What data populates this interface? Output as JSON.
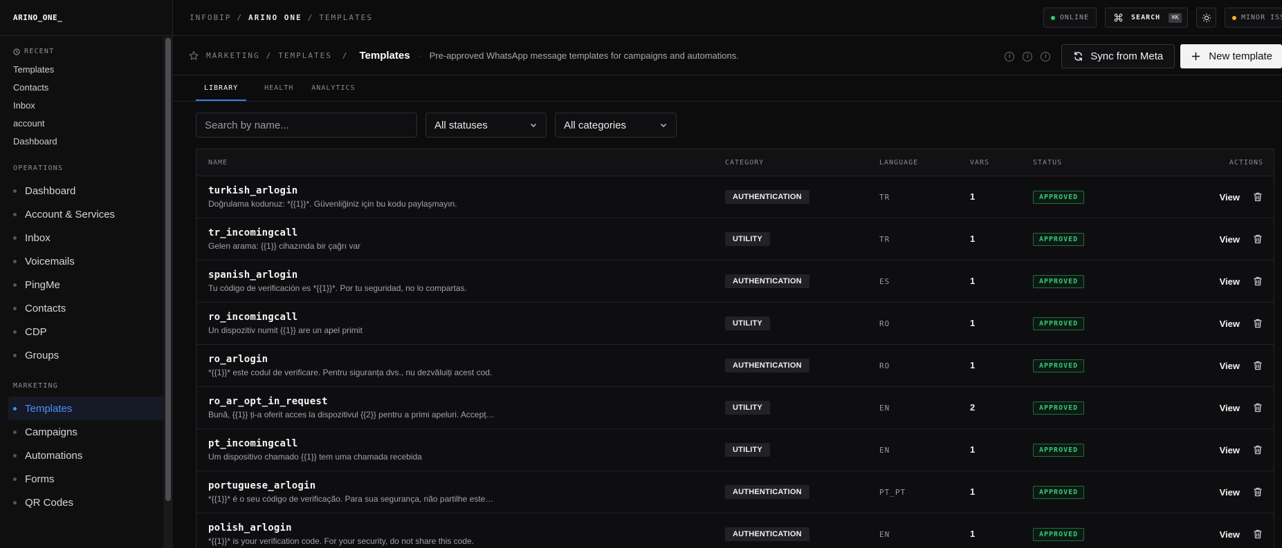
{
  "brand": "ARINO_ONE_",
  "sidebar": {
    "recent_heading": "RECENT",
    "recent": [
      "Templates",
      "Contacts",
      "Inbox",
      "account",
      "Dashboard"
    ],
    "operations_heading": "OPERATIONS",
    "operations": [
      "Dashboard",
      "Account & Services",
      "Inbox",
      "Voicemails",
      "PingMe",
      "Contacts",
      "CDP",
      "Groups"
    ],
    "marketing_heading": "MARKETING",
    "marketing": [
      "Templates",
      "Campaigns",
      "Automations",
      "Forms",
      "QR Codes"
    ],
    "active_item": "Templates",
    "accent": "#4d8dff"
  },
  "topbar": {
    "crumbs": [
      "INFOBIP",
      "/",
      "ARINO ONE",
      "/",
      "TEMPLATES"
    ],
    "online_label": "ONLINE",
    "online_color": "#2ecc71",
    "search_label": "SEARCH",
    "search_shortcut": "⌘K",
    "issue_label": "MINOR ISSUE",
    "issue_color": "#f0b429"
  },
  "page": {
    "crumb_1": "MARKETING",
    "crumb_sep": "/",
    "crumb_2": "TEMPLATES",
    "crumb_sep2": "/",
    "title": "Templates",
    "sep": "·",
    "description": "Pre-approved WhatsApp message templates for campaigns and automations.",
    "sync_label": "Sync from Meta",
    "new_label": "New template"
  },
  "tabs": [
    "LIBRARY",
    "HEALTH",
    "ANALYTICS"
  ],
  "filters": {
    "search_placeholder": "Search by name...",
    "status_value": "All statuses",
    "category_value": "All categories"
  },
  "table": {
    "columns": [
      "NAME",
      "CATEGORY",
      "LANGUAGE",
      "VARS",
      "STATUS",
      "ACTIONS"
    ],
    "view_label": "View",
    "rows": [
      {
        "name": "turkish_arlogin",
        "body": "Doğrulama kodunuz: *{{1}}*. Güvenliğiniz için bu kodu paylaşmayın.",
        "category": "AUTHENTICATION",
        "language": "TR",
        "vars": "1",
        "status": "APPROVED"
      },
      {
        "name": "tr_incomingcall",
        "body": "Gelen arama: {{1}} cihazında bir çağrı var",
        "category": "UTILITY",
        "language": "TR",
        "vars": "1",
        "status": "APPROVED"
      },
      {
        "name": "spanish_arlogin",
        "body": "Tu código de verificación es *{{1}}*. Por tu seguridad, no lo compartas.",
        "category": "AUTHENTICATION",
        "language": "ES",
        "vars": "1",
        "status": "APPROVED"
      },
      {
        "name": "ro_incomingcall",
        "body": "Un dispozitiv numit {{1}} are un apel primit",
        "category": "UTILITY",
        "language": "RO",
        "vars": "1",
        "status": "APPROVED"
      },
      {
        "name": "ro_arlogin",
        "body": "*{{1}}* este codul de verificare. Pentru siguranța dvs., nu dezvăluiți acest cod.",
        "category": "AUTHENTICATION",
        "language": "RO",
        "vars": "1",
        "status": "APPROVED"
      },
      {
        "name": "ro_ar_opt_in_request",
        "body": "Bună, {{1}} ți-a oferit acces la dispozitivul {{2}} pentru a primi apeluri. Accepț…",
        "category": "UTILITY",
        "language": "EN",
        "vars": "2",
        "status": "APPROVED"
      },
      {
        "name": "pt_incomingcall",
        "body": "Um dispositivo chamado {{1}} tem uma chamada recebida",
        "category": "UTILITY",
        "language": "EN",
        "vars": "1",
        "status": "APPROVED"
      },
      {
        "name": "portuguese_arlogin",
        "body": "*{{1}}* é o seu código de verificação. Para sua segurança, não partilhe este…",
        "category": "AUTHENTICATION",
        "language": "PT_PT",
        "vars": "1",
        "status": "APPROVED"
      },
      {
        "name": "polish_arlogin",
        "body": "*{{1}}* is your verification code. For your security, do not share this code.",
        "category": "AUTHENTICATION",
        "language": "EN",
        "vars": "1",
        "status": "APPROVED"
      }
    ]
  }
}
